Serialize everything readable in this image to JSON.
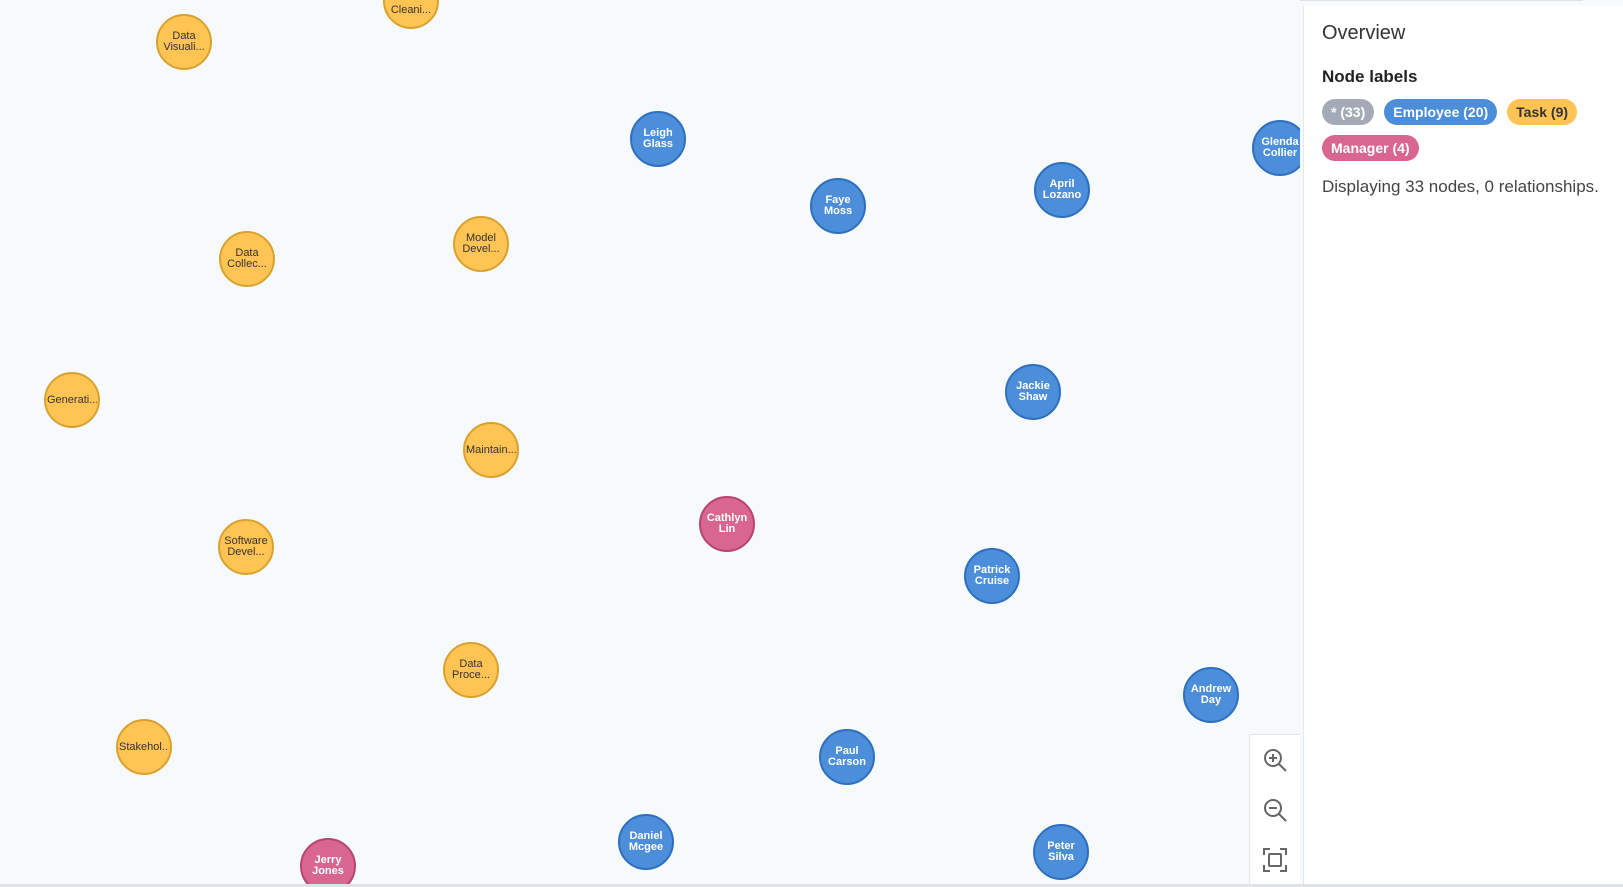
{
  "graph": {
    "nodes": [
      {
        "label": "Data\nVisuali...",
        "type": "task"
      },
      {
        "label": "Cleani...",
        "type": "task"
      },
      {
        "label": "Leigh\nGlass",
        "type": "employee"
      },
      {
        "label": "Glenda\nCollier",
        "type": "employee"
      },
      {
        "label": "Faye\nMoss",
        "type": "employee"
      },
      {
        "label": "April\nLozano",
        "type": "employee"
      },
      {
        "label": "Data\nCollec...",
        "type": "task"
      },
      {
        "label": "Model\nDevel...",
        "type": "task"
      },
      {
        "label": "Generati...",
        "type": "task"
      },
      {
        "label": "Jackie\nShaw",
        "type": "employee"
      },
      {
        "label": "Maintain...",
        "type": "task"
      },
      {
        "label": "Cathlyn\nLin",
        "type": "manager"
      },
      {
        "label": "Software\nDevel...",
        "type": "task"
      },
      {
        "label": "Patrick\nCruise",
        "type": "employee"
      },
      {
        "label": "Data\nProce...",
        "type": "task"
      },
      {
        "label": "Andrew\nDay",
        "type": "employee"
      },
      {
        "label": "Stakehol...",
        "type": "task"
      },
      {
        "label": "Paul\nCarson",
        "type": "employee"
      },
      {
        "label": "Daniel\nMcgee",
        "type": "employee"
      },
      {
        "label": "Peter\nSilva",
        "type": "employee"
      },
      {
        "label": "Jerry\nJones",
        "type": "manager"
      }
    ]
  },
  "zoom_controls": {
    "buttons": [
      "zoom-in-icon",
      "zoom-out-icon",
      "fit-to-screen-icon"
    ]
  },
  "overview": {
    "title": "Overview",
    "node_labels_heading": "Node labels",
    "chips": [
      {
        "label": "* (33)",
        "type": "all"
      },
      {
        "label": "Employee (20)",
        "type": "employee"
      },
      {
        "label": "Task (9)",
        "type": "task"
      },
      {
        "label": "Manager (4)",
        "type": "manager"
      }
    ],
    "summary": "Displaying 33 nodes, 0 relationships."
  },
  "colors": {
    "employee": "#4c8eda",
    "task": "#ffc454",
    "manager": "#d9668f",
    "all": "#a5abb6"
  }
}
